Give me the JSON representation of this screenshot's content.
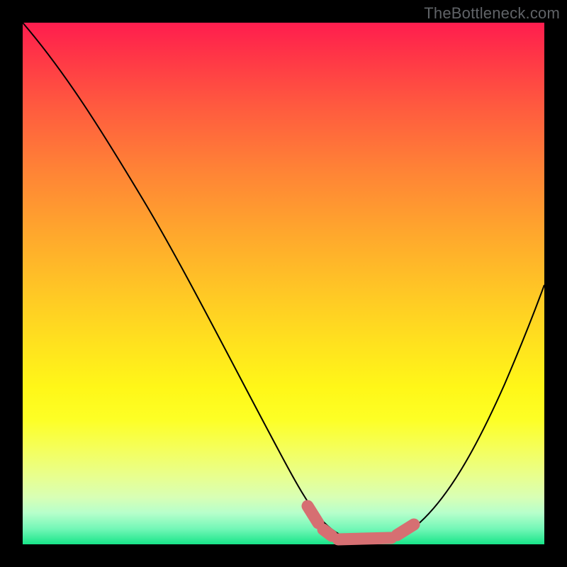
{
  "watermark": "TheBottleneck.com",
  "colors": {
    "background": "#000000",
    "curve": "#000000",
    "marker": "#d66f72",
    "gradient_stops": [
      "#ff1d4e",
      "#ff3447",
      "#ff5a3f",
      "#ff8236",
      "#ffa62d",
      "#ffc825",
      "#ffe31e",
      "#fff718",
      "#fdff25",
      "#f4ff5e",
      "#e8ff8f",
      "#d8ffb5",
      "#b6ffcb",
      "#74f7b7",
      "#18e589"
    ]
  },
  "chart_data": {
    "type": "line",
    "title": "",
    "xlabel": "",
    "ylabel": "",
    "xlim": [
      0,
      1
    ],
    "ylim": [
      0,
      1
    ],
    "series": [
      {
        "name": "bottleneck-curve",
        "x": [
          0.0,
          0.05,
          0.1,
          0.15,
          0.2,
          0.25,
          0.3,
          0.35,
          0.4,
          0.45,
          0.5,
          0.55,
          0.6,
          0.65,
          0.7,
          0.75,
          0.8,
          0.85,
          0.9,
          0.95,
          1.0
        ],
        "y": [
          1.0,
          0.93,
          0.85,
          0.77,
          0.68,
          0.59,
          0.5,
          0.41,
          0.32,
          0.23,
          0.13,
          0.06,
          0.02,
          0.0,
          0.0,
          0.02,
          0.08,
          0.17,
          0.28,
          0.41,
          0.55
        ]
      }
    ],
    "annotations": [
      {
        "name": "optimal-band",
        "shape": "rounded-segment",
        "x_range": [
          0.55,
          0.74
        ],
        "y": 0.01
      }
    ]
  }
}
